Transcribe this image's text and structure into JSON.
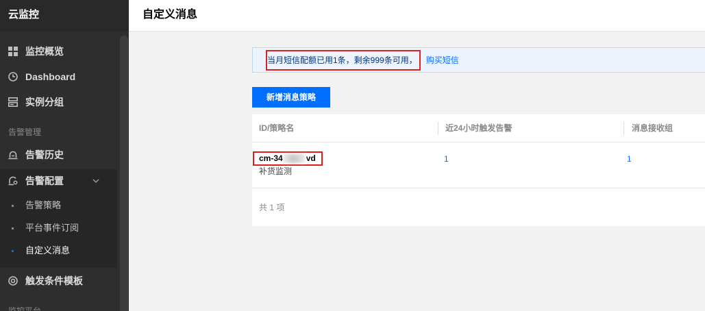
{
  "colors": {
    "accent": "#006eff",
    "sidebar_bg": "#2e2e2e",
    "notice_bg": "#edf4fe",
    "annotation_red": "#dd1f1f"
  },
  "sidebar": {
    "title": "云监控",
    "nav": [
      {
        "label": "监控概览",
        "icon": "grid-icon"
      },
      {
        "label": "Dashboard",
        "icon": "clock-icon"
      },
      {
        "label": "实例分组",
        "icon": "group-icon"
      }
    ],
    "alarm_section": {
      "label": "告警管理",
      "history": {
        "label": "告警历史",
        "icon": "alarm-history-icon"
      },
      "config": {
        "label": "告警配置",
        "icon": "alarm-config-icon",
        "expanded": true,
        "children": [
          {
            "label": "告警策略",
            "active": false
          },
          {
            "label": "平台事件订阅",
            "active": false
          },
          {
            "label": "自定义消息",
            "active": true
          }
        ]
      },
      "trigger_template": {
        "label": "触发条件模板",
        "icon": "target-icon"
      }
    },
    "next_section_label": "监控平台"
  },
  "main": {
    "title": "自定义消息",
    "notice": {
      "text": "当月短信配额已用1条，剩余999条可用，",
      "link": "购买短信"
    },
    "create_button": "新增消息策略",
    "table": {
      "columns": [
        "ID/策略名",
        "近24小时触发告警",
        "消息接收组"
      ],
      "rows": [
        {
          "id_start": "cm-34",
          "id_end": "vd",
          "id_redacted": true,
          "name": "补货监测",
          "alarms_24h": "1",
          "receiver_groups": "1"
        }
      ],
      "footer": "共 1 项"
    }
  }
}
